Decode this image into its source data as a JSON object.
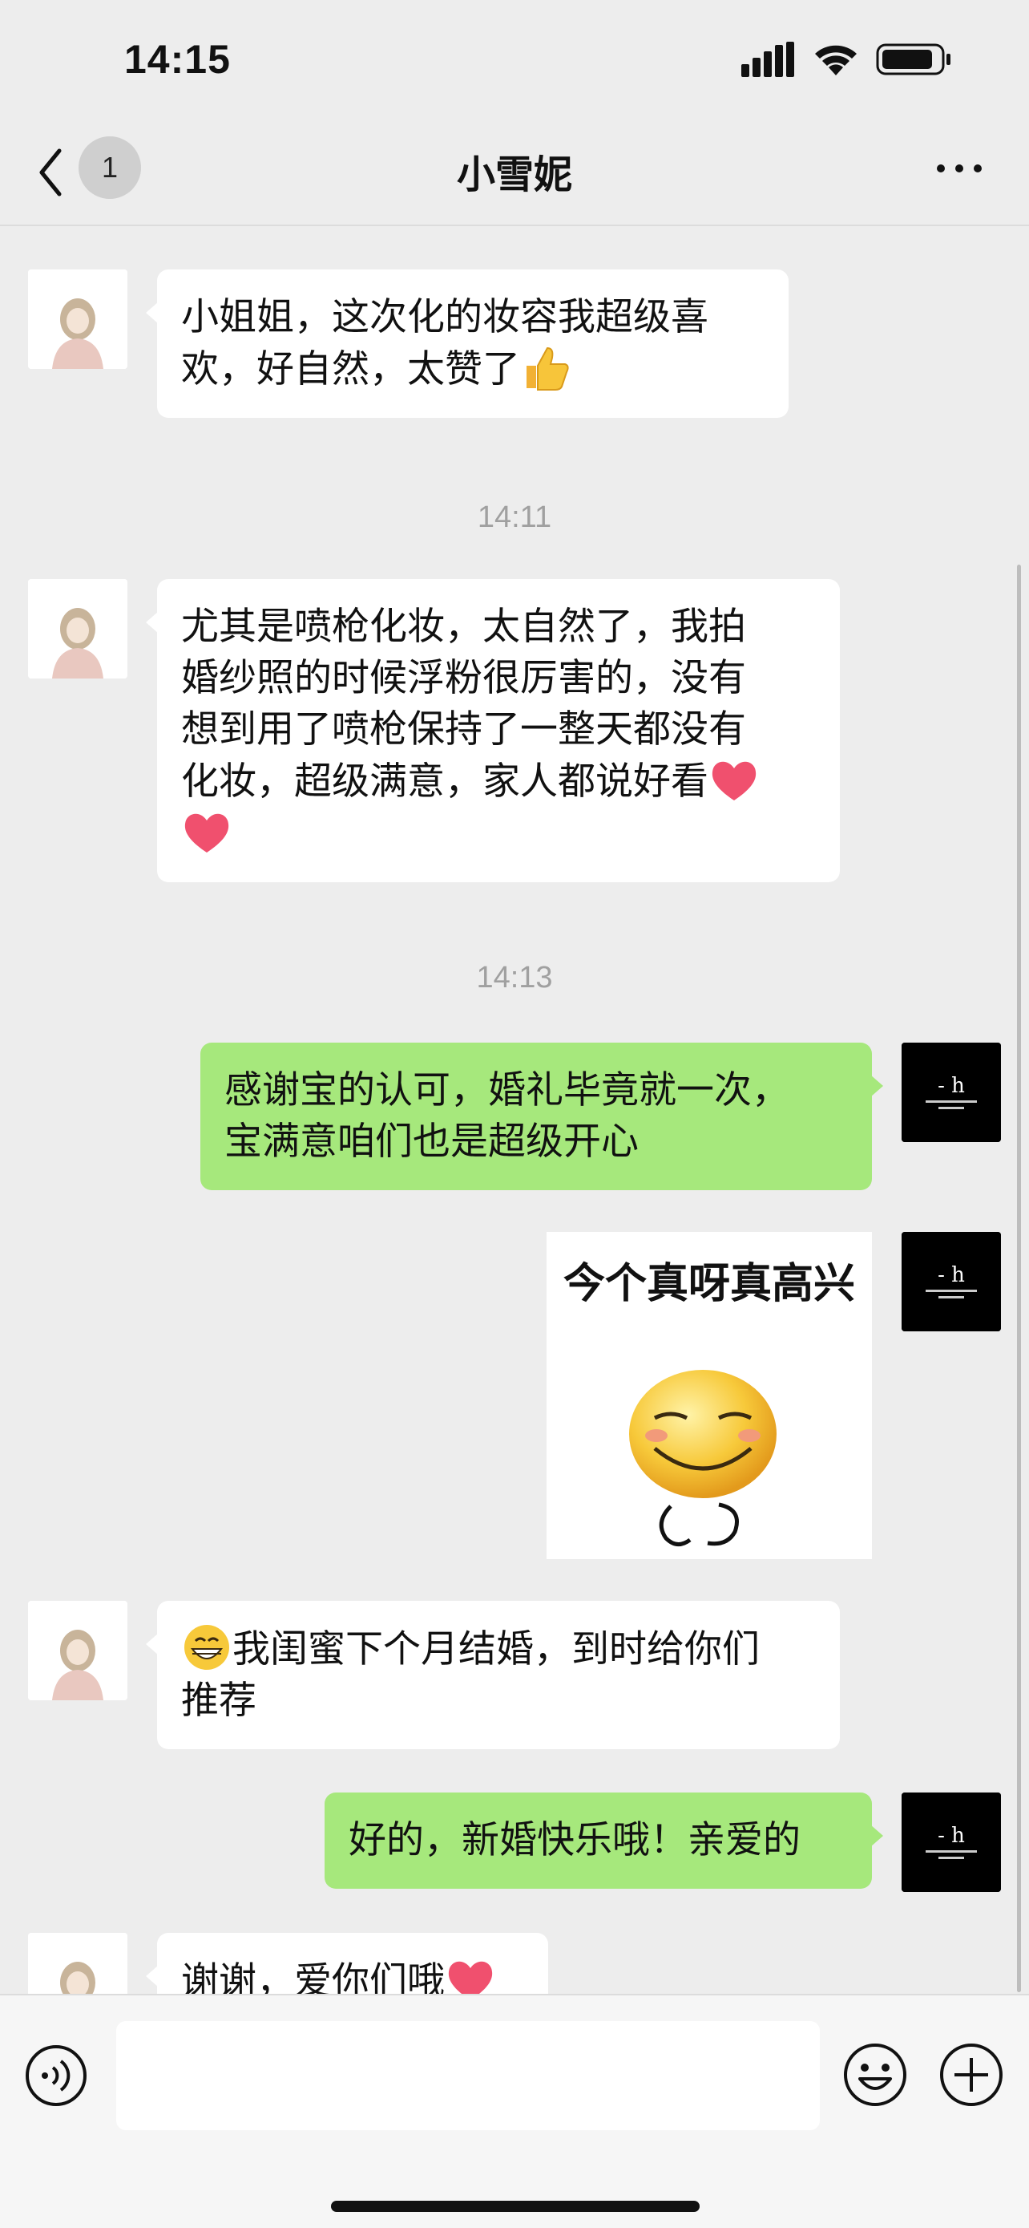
{
  "status_bar": {
    "time": "14:15"
  },
  "nav": {
    "back_count": "1",
    "title": "小雪妮"
  },
  "messages": [
    {
      "side": "in",
      "text": "小姐姐，这次化的妆容我超级喜欢，好自然，太赞了",
      "emoji": "thumbs-up"
    },
    {
      "type": "timestamp",
      "text": "14:11"
    },
    {
      "side": "in",
      "text": "尤其是喷枪化妆，太自然了，我拍婚纱照的时候浮粉很厉害的，没有想到用了喷枪保持了一整天都没有化妆，超级满意，家人都说好看",
      "emoji": "heart"
    },
    {
      "type": "timestamp",
      "text": "14:13"
    },
    {
      "side": "out",
      "text": "感谢宝的认可，婚礼毕竟就一次，宝满意咱们也是超级开心"
    },
    {
      "side": "out",
      "type": "sticker",
      "caption": "今个真呀真高兴"
    },
    {
      "side": "in",
      "text": "我闺蜜下个月结婚，到时给你们推荐",
      "emoji": "grin"
    },
    {
      "side": "out",
      "text": "好的，新婚快乐哦！亲爱的"
    },
    {
      "side": "in",
      "text": "谢谢，爱你们哦",
      "emoji": "heart"
    }
  ],
  "line_breaks": {
    "m0": [
      "小姐姐，这次化的妆容我超级喜",
      "欢，好自然，太赞了"
    ],
    "m2": [
      "尤其是喷枪化妆，太自然了，我拍",
      "婚纱照的时候浮粉很厉害的，没有",
      "想到用了喷枪保持了一整天都没有",
      "化妆，超级满意，家人都说好看"
    ],
    "m4": [
      "感谢宝的认可，婚礼毕竟就一次，",
      "宝满意咱们也是超级开心"
    ],
    "m6": [
      "我闺蜜下个月结婚，到时给你们",
      "推荐"
    ]
  },
  "input": {
    "placeholder": ""
  },
  "colors": {
    "background": "#ededed",
    "incoming_bubble": "#ffffff",
    "outgoing_bubble": "#a6e87c",
    "timestamp": "#a0a0a0"
  },
  "icons": [
    "back-icon",
    "more-icon",
    "voice-icon",
    "emoji-icon",
    "plus-icon",
    "signal-icon",
    "wifi-icon",
    "battery-icon"
  ]
}
